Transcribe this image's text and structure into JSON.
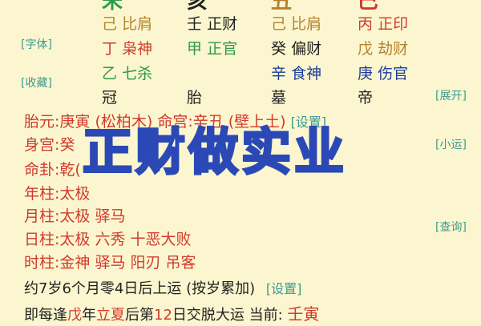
{
  "top_row": [
    "未",
    "亥",
    "丑",
    "巳"
  ],
  "side_buttons": {
    "font": "[字体]",
    "collect": "[收藏]",
    "expand": "[展开]",
    "minor_luck": "[小运]",
    "query": "[查询]"
  },
  "pillars": {
    "r1": [
      {
        "stem": "己",
        "god": "比肩",
        "color": "#b5832e"
      },
      {
        "stem": "壬",
        "god": "正财",
        "color": "#222222"
      },
      {
        "stem": "己",
        "god": "比肩",
        "color": "#b5832e"
      },
      {
        "stem": "丙",
        "god": "正印",
        "color": "#d23a2e"
      }
    ],
    "r2": [
      {
        "stem": "丁",
        "god": "枭神",
        "color": "#d23a2e"
      },
      {
        "stem": "甲",
        "god": "正官",
        "color": "#2d9a48"
      },
      {
        "stem": "癸",
        "god": "偏财",
        "color": "#222222"
      },
      {
        "stem": "戊",
        "god": "劫财",
        "color": "#b5832e"
      }
    ],
    "r3": [
      {
        "stem": "乙",
        "god": "七杀",
        "color": "#2d9a48"
      },
      null,
      {
        "stem": "辛",
        "god": "食神",
        "color": "#1c3c9c"
      },
      {
        "stem": "庚",
        "god": "伤官",
        "color": "#1c3c9c"
      }
    ]
  },
  "stages": [
    "冠",
    "胎",
    "墓",
    "帝"
  ],
  "info": {
    "taiyuan_label": "胎元:",
    "taiyuan_value": "庚寅 (松柏木)",
    "minggong_label": "命宫:",
    "minggong_value": "辛丑 (壁上土)",
    "settings": "[设置]",
    "shengong_label": "身宫:",
    "shengong_value": "癸",
    "minggua_label": "命卦:",
    "minggua_value": "乾(",
    "nianzhu_label": "年柱:",
    "nianzhu_value": "太极",
    "yuezhu_label": "月柱:",
    "yuezhu_value": "太极 驿马",
    "rizhu_label": "日柱:",
    "rizhu_value": "太极 六秀 十恶大败",
    "shizhu_label": "时柱:",
    "shizhu_value": "金神 驿马 阳刃 吊客"
  },
  "luck": {
    "start_text": "约7岁6个月零4日后上运 (按岁累加)",
    "settings": "[设置]",
    "bottom_prefix": "即每逢",
    "bottom_year": "戊",
    "bottom_mid": "年",
    "bottom_term": "立夏",
    "bottom_after": "后第",
    "bottom_day": "12",
    "bottom_suffix": "日交脱大运 当前: ",
    "bottom_current": "壬寅"
  },
  "overlay_title": "正财做实业"
}
